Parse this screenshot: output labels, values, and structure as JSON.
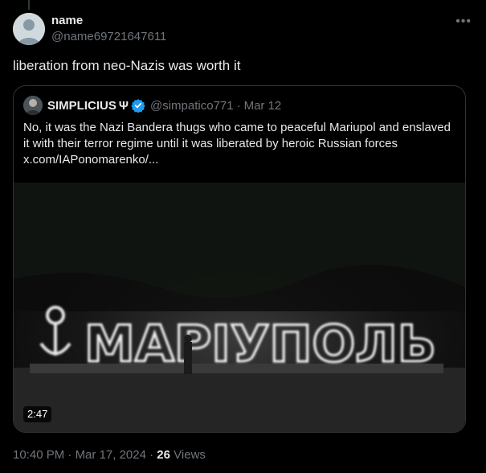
{
  "tweet": {
    "author_name": "name",
    "author_handle": "@name69721647611",
    "more_icon": "more-horizontal-icon",
    "text": "liberation from neo-Nazis was worth it",
    "time": "10:40 PM",
    "date": "Mar 17, 2024",
    "views_count": "26",
    "views_label": "Views",
    "separator": "·"
  },
  "quote": {
    "author_name": "SIMPLICIUS",
    "author_suffix": "Ψ",
    "verified_icon": "verified-badge-icon",
    "verified_color": "#1d9bf0",
    "handle": "@simpatico771",
    "separator": "·",
    "date": "Mar 12",
    "text": "No, it was the Nazi Bandera thugs who came to peaceful Mariupol and enslaved it with their terror regime until it was liberated by heroic Russian forces",
    "link": "x.com/IAPonomarenko/...",
    "media": {
      "sign_text": "МАРІУПОЛЬ",
      "duration": "2:47"
    }
  }
}
